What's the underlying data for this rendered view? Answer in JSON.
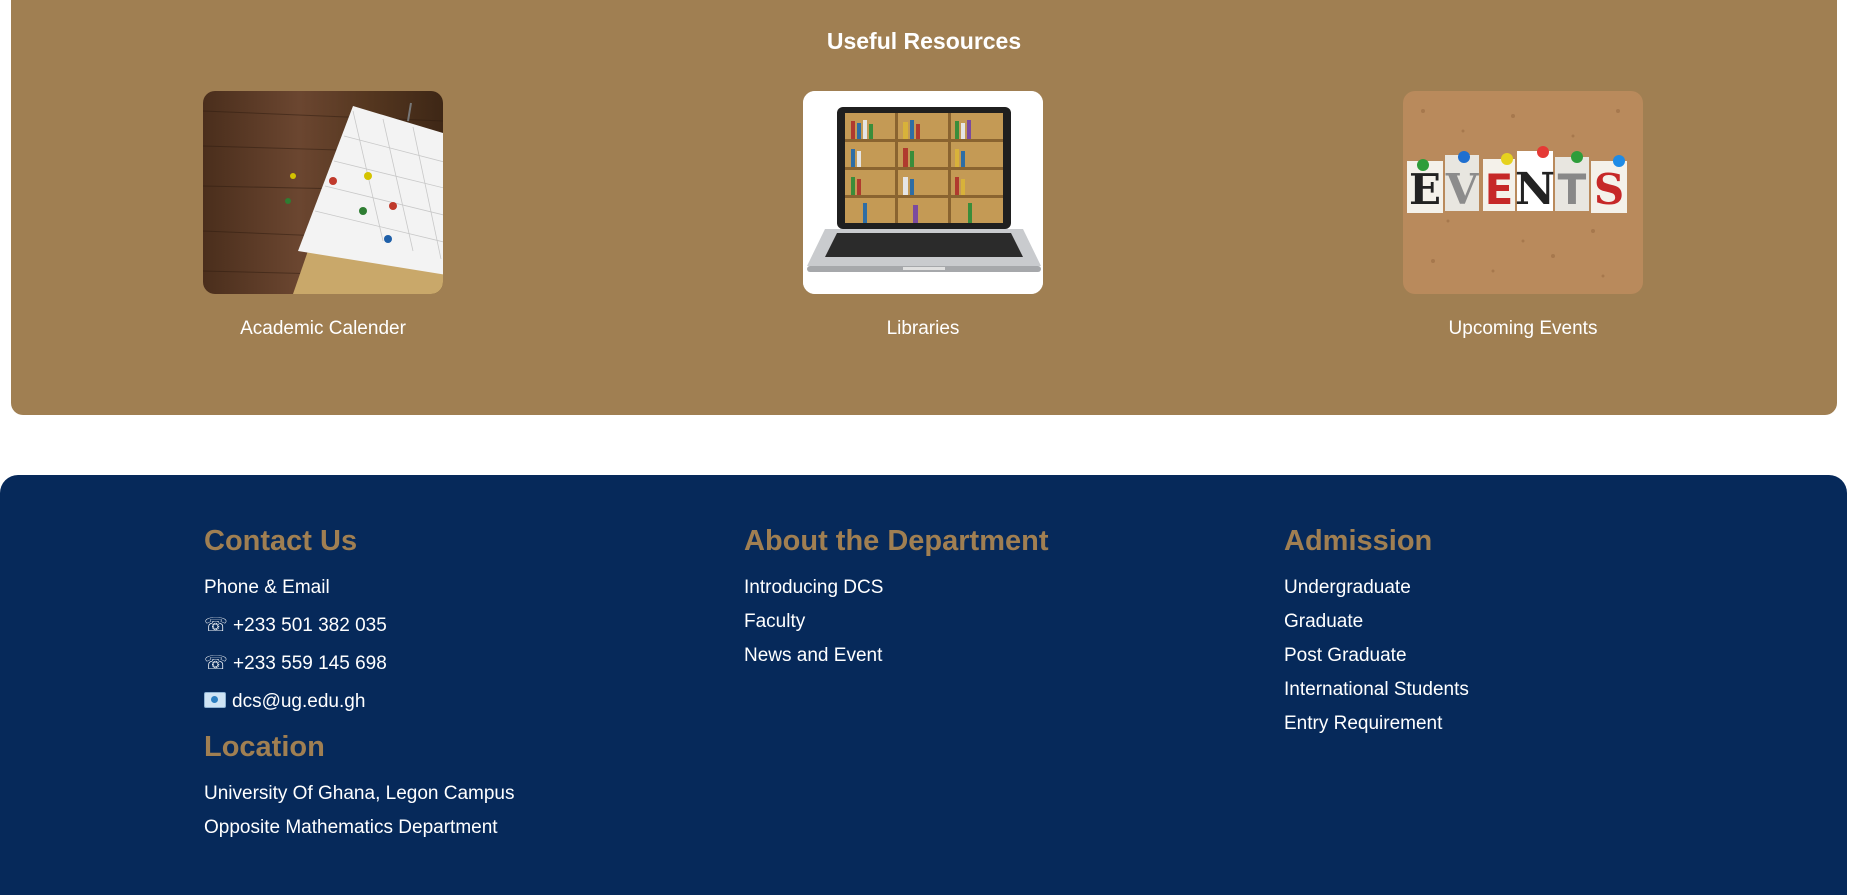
{
  "resources": {
    "title": "Useful Resources",
    "cards": [
      {
        "caption": "Academic Calender",
        "icon": "calendar-image"
      },
      {
        "caption": "Libraries",
        "icon": "laptop-bookshelf-image"
      },
      {
        "caption": "Upcoming Events",
        "icon": "events-board-image"
      }
    ],
    "events_board_text": "EVENTS"
  },
  "footer": {
    "contact": {
      "title": "Contact Us",
      "subtitle": "Phone & Email",
      "phone_icon": "☏",
      "phone1": "+233 501 382 035",
      "phone2": "+233 559 145 698",
      "email": "dcs@ug.edu.gh"
    },
    "location": {
      "title": "Location",
      "line1": "University Of Ghana, Legon Campus",
      "line2": "Opposite Mathematics Department"
    },
    "about": {
      "title": "About the Department",
      "links": [
        "Introducing DCS",
        "Faculty",
        "News and Event"
      ]
    },
    "admission": {
      "title": "Admission",
      "links": [
        "Undergraduate",
        "Graduate",
        "Post Graduate",
        "International Students",
        "Entry Requirement"
      ]
    }
  },
  "colors": {
    "brand_tan": "#a07f52",
    "brand_navy": "#06295a"
  }
}
